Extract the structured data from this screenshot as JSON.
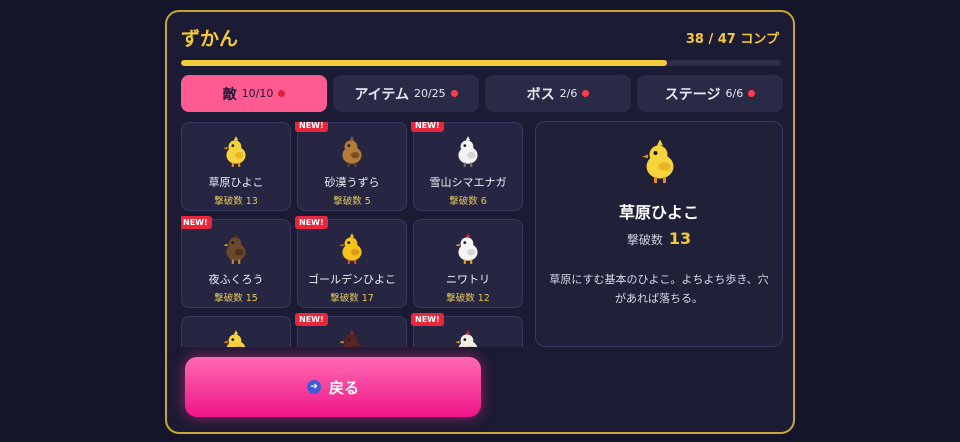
{
  "header": {
    "title": "ずかん",
    "progress_text": "38 / 47 コンプ",
    "progress_fraction": 0.81
  },
  "tabs": [
    {
      "label": "敵",
      "count": "10/10",
      "active": true,
      "has_dot": true
    },
    {
      "label": "アイテム",
      "count": "20/25",
      "active": false,
      "has_dot": true
    },
    {
      "label": "ボス",
      "count": "2/6",
      "active": false,
      "has_dot": true
    },
    {
      "label": "ステージ",
      "count": "6/6",
      "active": false,
      "has_dot": true
    }
  ],
  "entries": [
    {
      "name": "草原ひよこ",
      "kills": "撃破数 13",
      "new": false,
      "icon": "yellow-chick-icon",
      "new_label": ""
    },
    {
      "name": "砂漠うずら",
      "kills": "撃破数 5",
      "new": true,
      "icon": "quail-icon",
      "new_label": "NEW!"
    },
    {
      "name": "雪山シマエナガ",
      "kills": "撃破数 6",
      "new": true,
      "icon": "white-bird-icon",
      "new_label": "NEW!"
    },
    {
      "name": "夜ふくろう",
      "kills": "撃破数 15",
      "new": true,
      "icon": "owl-icon",
      "new_label": "NEW!"
    },
    {
      "name": "ゴールデンひよこ",
      "kills": "撃破数 17",
      "new": true,
      "icon": "golden-chick-icon",
      "new_label": "NEW!"
    },
    {
      "name": "ニワトリ",
      "kills": "撃破数 12",
      "new": false,
      "icon": "chicken-icon",
      "new_label": ""
    },
    {
      "name": "",
      "kills": "",
      "new": false,
      "icon": "yellow-chick-icon",
      "new_label": ""
    },
    {
      "name": "",
      "kills": "",
      "new": true,
      "icon": "dark-bird-icon",
      "new_label": "NEW!"
    },
    {
      "name": "",
      "kills": "",
      "new": true,
      "icon": "white-chicken-icon",
      "new_label": "NEW!"
    }
  ],
  "detail": {
    "name": "草原ひよこ",
    "kills_label": "撃破数",
    "kills_value": "13",
    "description": "草原にすむ基本のひよこ。よちよち歩き、穴があれば落ちる。",
    "icon": "yellow-chick-icon"
  },
  "back_button": {
    "label": "戻る",
    "icon": "arrow-right-icon"
  },
  "colors": {
    "accent": "#f5c93c",
    "active_tab": "#ff5b92",
    "button": "#f0158a",
    "badge": "#e8273c"
  }
}
